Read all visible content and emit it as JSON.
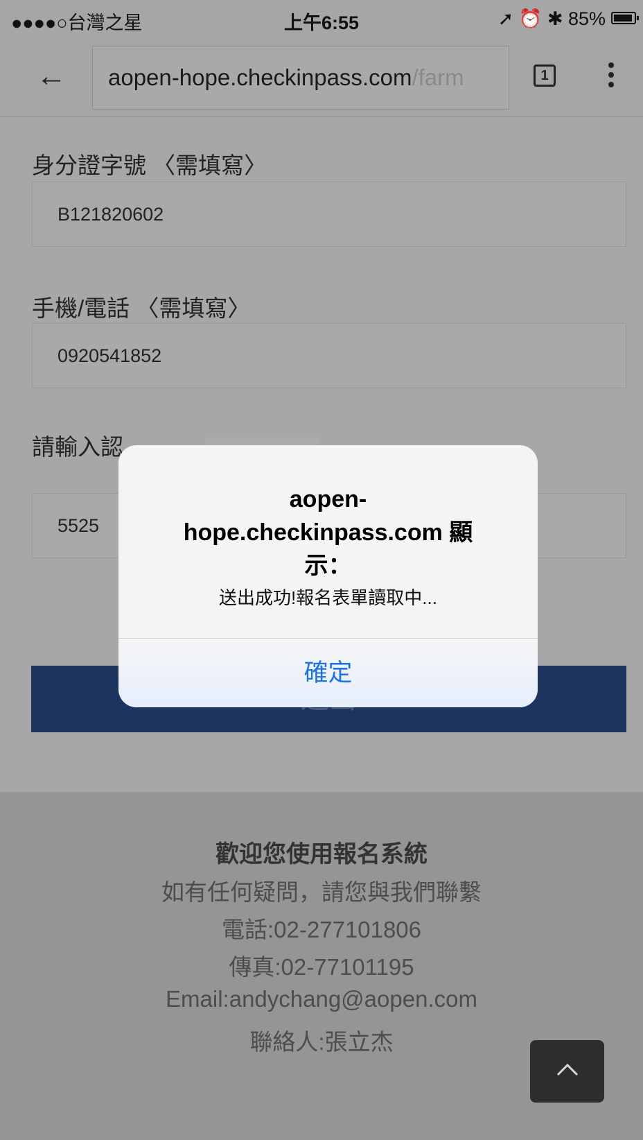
{
  "status_bar": {
    "carrier": "●●●●○台灣之星",
    "wifi": "wifi-icon",
    "time": "上午6:55",
    "right": "➚ ⏰ ✱ 85%"
  },
  "browser": {
    "url_domain": "aopen-hope.checkinpass.com",
    "url_path": "/farm",
    "tab_count": "1"
  },
  "form": {
    "id_label": "身分證字號 〈需填寫〉",
    "id_value": "B121820602",
    "phone_label": "手機/電話 〈需填寫〉",
    "phone_value": "0920541852",
    "captcha_label": "請輸入認",
    "captcha_value": "5525",
    "submit_label": "送出"
  },
  "footer": {
    "title": "歡迎您使用報名系統",
    "line1": "如有任何疑問，請您與我們聯繫",
    "phone": "電話:02-277101806",
    "fax": "傳真:02-77101195",
    "email": "Email:andychang@aopen.com",
    "contact": "聯絡人:張立杰"
  },
  "dialog": {
    "title_1": "aopen-",
    "title_2": "hope.checkinpass.com 顯",
    "title_3": "示：",
    "message": "送出成功!報名表單讀取中...",
    "ok_label": "確定"
  }
}
